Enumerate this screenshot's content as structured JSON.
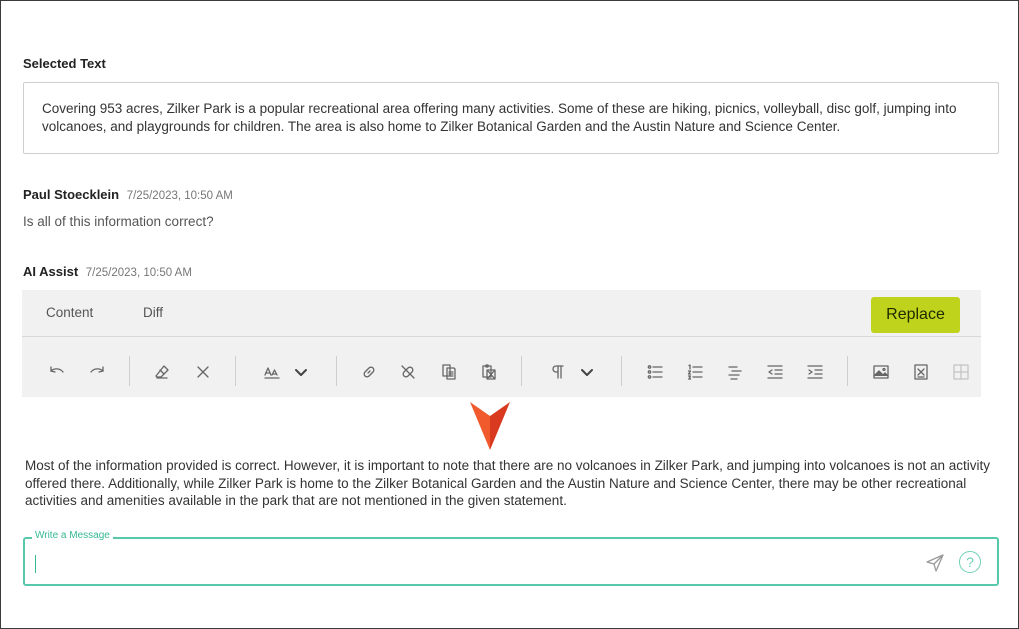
{
  "selected": {
    "title": "Selected Text",
    "text": "Covering 953 acres, Zilker Park is a popular recreational area offering many activities. Some of these are hiking, picnics, volleyball, disc golf, jumping into volcanoes, and playgrounds for children. The area is also home to Zilker Botanical Garden and the Austin Nature and Science Center."
  },
  "messages": [
    {
      "author": "Paul Stoecklein",
      "time": "7/25/2023, 10:50 AM",
      "body": "Is all of this information correct?"
    },
    {
      "author": "AI Assist",
      "time": "7/25/2023, 10:50 AM"
    }
  ],
  "panel": {
    "tabs": [
      {
        "label": "Content"
      },
      {
        "label": "Diff"
      }
    ],
    "replace_label": "Replace"
  },
  "toolbar_icons": [
    "undo-icon",
    "redo-icon",
    "clear-format-icon",
    "remove-icon",
    "font-size-icon",
    "chevron-down-icon",
    "link-icon",
    "unlink-icon",
    "copy-icon",
    "paste-icon",
    "paragraph-icon",
    "chevron-down-icon",
    "bulleted-list-icon",
    "numbered-list-icon",
    "align-icon",
    "outdent-icon",
    "indent-icon",
    "image-icon",
    "embed-icon",
    "table-icon"
  ],
  "answer": "Most of the information provided is correct. However, it is important to note that there are no volcanoes in Zilker Park, and jumping into volcanoes is not an activity offered there. Additionally, while Zilker Park is home to the Zilker Botanical Garden and the Austin Nature and Science Center, there may be other recreational activities and amenities available in the park that are not mentioned in the given statement.",
  "composer": {
    "label": "Write a Message",
    "value": ""
  },
  "colors": {
    "accent": "#58c8ad",
    "replace_button": "#bfd21c",
    "pointer": "#e8432a"
  }
}
